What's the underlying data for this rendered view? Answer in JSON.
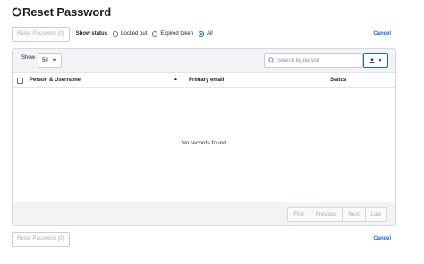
{
  "page": {
    "title": "Reset Password"
  },
  "toolbar": {
    "reset_button_label": "Reset Password (0)",
    "show_status_label": "Show status",
    "status_options": [
      {
        "label": "Locked out",
        "selected": false
      },
      {
        "label": "Expired token",
        "selected": false
      },
      {
        "label": "All",
        "selected": true
      }
    ],
    "cancel_label": "Cancel"
  },
  "table_controls": {
    "show_label": "Show",
    "page_size": "50",
    "search_placeholder": "Search by person"
  },
  "table": {
    "columns": [
      "Person & Username",
      "Primary email",
      "Status"
    ],
    "sort_column": "Person & Username",
    "sort_direction": "ascending",
    "rows": [],
    "empty_text": "No records found"
  },
  "pagination": {
    "first": "First",
    "previous": "Previous",
    "next": "Next",
    "last": "Last"
  },
  "footer": {
    "reset_button_label": "Reset Password (0)",
    "cancel_label": "Cancel"
  },
  "colors": {
    "accent": "#1662dd",
    "disabled_text": "#a7abb8",
    "panel_header_bg": "#f2f3f5"
  },
  "icons": {
    "logo": "spinner-logo-icon",
    "search": "search-icon",
    "user_filter": "user-icon",
    "dropdown": "chevron-down-icon",
    "sort": "sort-asc-icon"
  }
}
